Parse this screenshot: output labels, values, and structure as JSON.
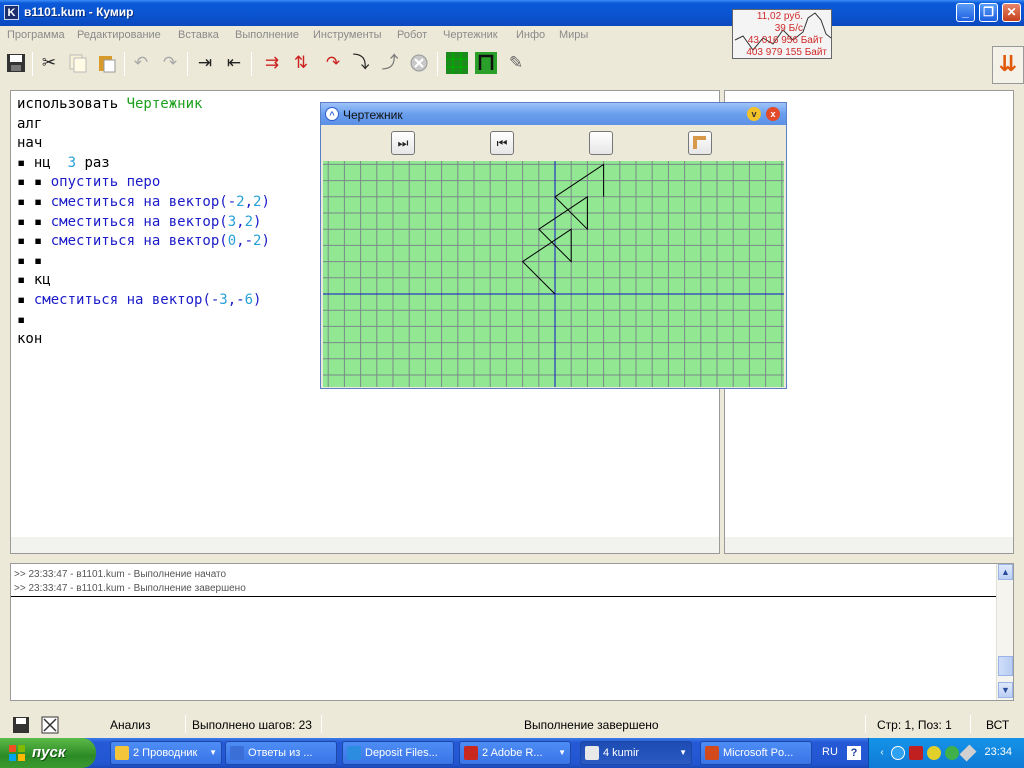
{
  "window": {
    "title": "в1101.kum - Кумир",
    "app_icon_letter": "K"
  },
  "monitor": {
    "rate": "11,02 руб.",
    "speed": "39 Б/с",
    "received": "43 016 956 Байт",
    "sent": "403 979 155 Байт"
  },
  "menu": [
    "Программа",
    "Редактирование",
    "Вставка",
    "Выполнение",
    "Инструменты",
    "Робот",
    "Чертежник",
    "Инфо",
    "Миры"
  ],
  "editor": {
    "lines": [
      {
        "indent": "",
        "parts": [
          {
            "t": "использовать ",
            "c": ""
          },
          {
            "t": "Чертежник",
            "c": "kw-g"
          }
        ]
      },
      {
        "indent": "",
        "parts": [
          {
            "t": "алг",
            "c": ""
          }
        ]
      },
      {
        "indent": "",
        "parts": [
          {
            "t": "нач",
            "c": ""
          }
        ]
      },
      {
        "indent": "▪ ",
        "parts": [
          {
            "t": "нц  ",
            "c": ""
          },
          {
            "t": "3",
            "c": "num"
          },
          {
            "t": " раз",
            "c": ""
          }
        ]
      },
      {
        "indent": "▪ ▪ ",
        "parts": [
          {
            "t": "опустить перо",
            "c": "kw-b"
          }
        ]
      },
      {
        "indent": "▪ ▪ ",
        "parts": [
          {
            "t": "сместиться на вектор",
            "c": "kw-b"
          },
          {
            "t": "(-",
            "c": "kw-b"
          },
          {
            "t": "2",
            "c": "num"
          },
          {
            "t": ",",
            "c": "kw-b"
          },
          {
            "t": "2",
            "c": "num"
          },
          {
            "t": ")",
            "c": "kw-b"
          }
        ]
      },
      {
        "indent": "▪ ▪ ",
        "parts": [
          {
            "t": "сместиться на вектор",
            "c": "kw-b"
          },
          {
            "t": "(",
            "c": "kw-b"
          },
          {
            "t": "3",
            "c": "num"
          },
          {
            "t": ",",
            "c": "kw-b"
          },
          {
            "t": "2",
            "c": "num"
          },
          {
            "t": ")",
            "c": "kw-b"
          }
        ]
      },
      {
        "indent": "▪ ▪ ",
        "parts": [
          {
            "t": "сместиться на вектор",
            "c": "kw-b"
          },
          {
            "t": "(",
            "c": "kw-b"
          },
          {
            "t": "0",
            "c": "num"
          },
          {
            "t": ",-",
            "c": "kw-b"
          },
          {
            "t": "2",
            "c": "num"
          },
          {
            "t": ")",
            "c": "kw-b"
          }
        ]
      },
      {
        "indent": "▪ ▪",
        "parts": []
      },
      {
        "indent": "▪ ",
        "parts": [
          {
            "t": "кц",
            "c": ""
          }
        ]
      },
      {
        "indent": "▪ ",
        "parts": [
          {
            "t": "сместиться на вектор",
            "c": "kw-b"
          },
          {
            "t": "(-",
            "c": "kw-b"
          },
          {
            "t": "3",
            "c": "num"
          },
          {
            "t": ",-",
            "c": "kw-b"
          },
          {
            "t": "6",
            "c": "num"
          },
          {
            "t": ")",
            "c": "kw-b"
          }
        ]
      },
      {
        "indent": "▪",
        "parts": []
      },
      {
        "indent": "",
        "parts": [
          {
            "t": "кон",
            "c": ""
          }
        ]
      }
    ]
  },
  "drawer": {
    "title": "Чертежник",
    "min_label": "v",
    "close_label": "x",
    "drawing": {
      "start": [
        0,
        0
      ],
      "moves": [
        [
          -2,
          2
        ],
        [
          3,
          2
        ],
        [
          0,
          -2
        ],
        [
          -2,
          2
        ],
        [
          3,
          2
        ],
        [
          0,
          -2
        ],
        [
          -2,
          2
        ],
        [
          3,
          2
        ],
        [
          0,
          -2
        ]
      ],
      "final_move": [
        -3,
        -6
      ]
    }
  },
  "console": {
    "lines": [
      ">> 23:33:47 - в1101.kum - Выполнение начато",
      ">> 23:33:47 - в1101.kum - Выполнение завершено"
    ]
  },
  "status": {
    "analysis": "Анализ",
    "steps": "Выполнено шагов: 23",
    "state": "Выполнение завершено",
    "position": "Стр: 1, Поз: 1",
    "mode": "ВСТ"
  },
  "taskbar": {
    "start": "пуск",
    "tasks": [
      {
        "label": "2 Проводник",
        "color": "#f3c53a",
        "active": false,
        "grouped": true
      },
      {
        "label": "Ответы из ...",
        "color": "#3a6fd8",
        "active": false,
        "grouped": false
      },
      {
        "label": "Deposit Files...",
        "color": "#2c8ce0",
        "active": false,
        "grouped": false
      },
      {
        "label": "2 Adobe R...",
        "color": "#c8281e",
        "active": false,
        "grouped": true
      },
      {
        "label": "4 kumir",
        "color": "#e8e8e8",
        "active": true,
        "grouped": true
      },
      {
        "label": "Microsoft Po...",
        "color": "#d24a1c",
        "active": false,
        "grouped": false
      }
    ],
    "lang": "RU",
    "clock": "23:34"
  }
}
